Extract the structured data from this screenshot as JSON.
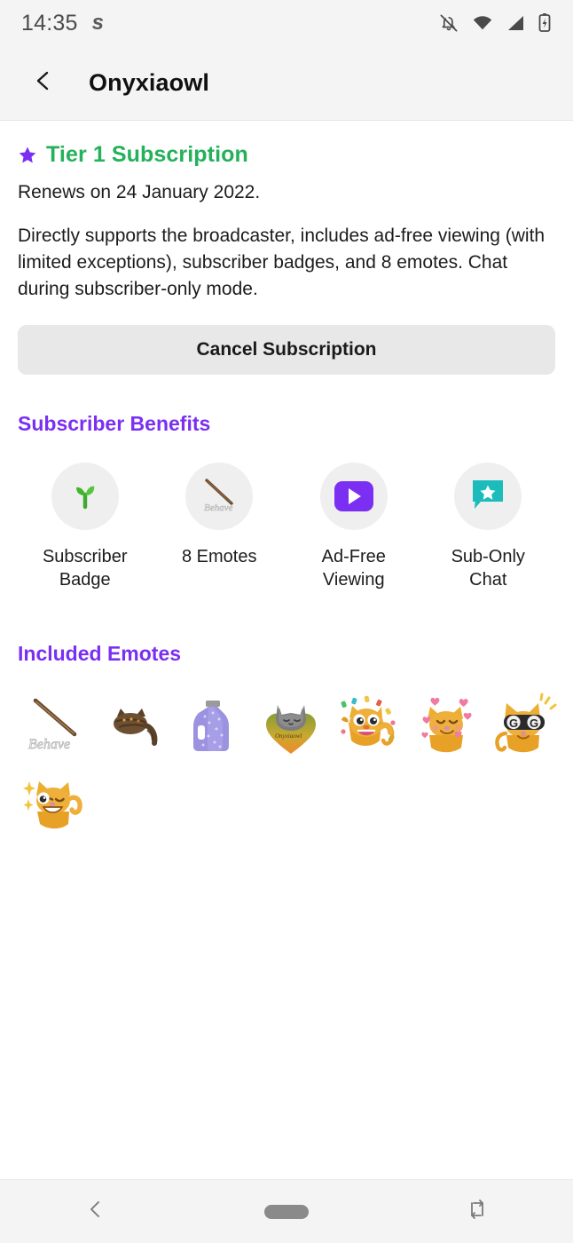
{
  "status_bar": {
    "time": "14:35",
    "app_icon": "s",
    "icons": [
      "notifications-off-icon",
      "wifi-icon",
      "cellular-signal-icon",
      "battery-charging-icon"
    ]
  },
  "app_bar": {
    "back_icon": "chevron-left-icon",
    "title": "Onyxiaowl"
  },
  "subscription": {
    "star_icon": "star-icon",
    "tier_title": "Tier 1 Subscription",
    "tier_color": "#24b159",
    "star_color": "#7b2ff2",
    "renews_text": "Renews on 24 January 2022.",
    "description": "Directly supports the broadcaster, includes ad-free viewing (with limited exceptions), subscriber badges, and 8 emotes. Chat during subscriber-only mode.",
    "cancel_label": "Cancel Subscription"
  },
  "benefits_section": {
    "heading": "Subscriber Benefits",
    "heading_color": "#7b2ff2",
    "items": [
      {
        "label": "Subscriber Badge",
        "icon": "sprout-badge-icon"
      },
      {
        "label": "8 Emotes",
        "icon": "behave-stick-emote-icon"
      },
      {
        "label": "Ad-Free Viewing",
        "icon": "play-button-icon"
      },
      {
        "label": "Sub-Only Chat",
        "icon": "chat-star-icon"
      }
    ]
  },
  "emotes_section": {
    "heading": "Included Emotes",
    "heading_color": "#7b2ff2",
    "count": 8,
    "items": [
      {
        "name": "behave-stick-emote",
        "label": "Behave"
      },
      {
        "name": "tabby-cat-loaf-emote",
        "label": "CatLoaf"
      },
      {
        "name": "purple-jug-emote",
        "label": "Jug"
      },
      {
        "name": "grey-cat-heart-emote",
        "label": "CatHeart"
      },
      {
        "name": "orange-cat-hype-emote",
        "label": "Hype"
      },
      {
        "name": "orange-cat-love-emote",
        "label": "Love"
      },
      {
        "name": "orange-cat-gg-emote",
        "label": "GG"
      },
      {
        "name": "orange-cat-wave-emote",
        "label": "Wave"
      }
    ]
  },
  "nav_bar": {
    "back_icon": "nav-back-icon",
    "home_icon": "nav-home-pill-icon",
    "rotate_icon": "nav-rotate-screen-icon"
  }
}
